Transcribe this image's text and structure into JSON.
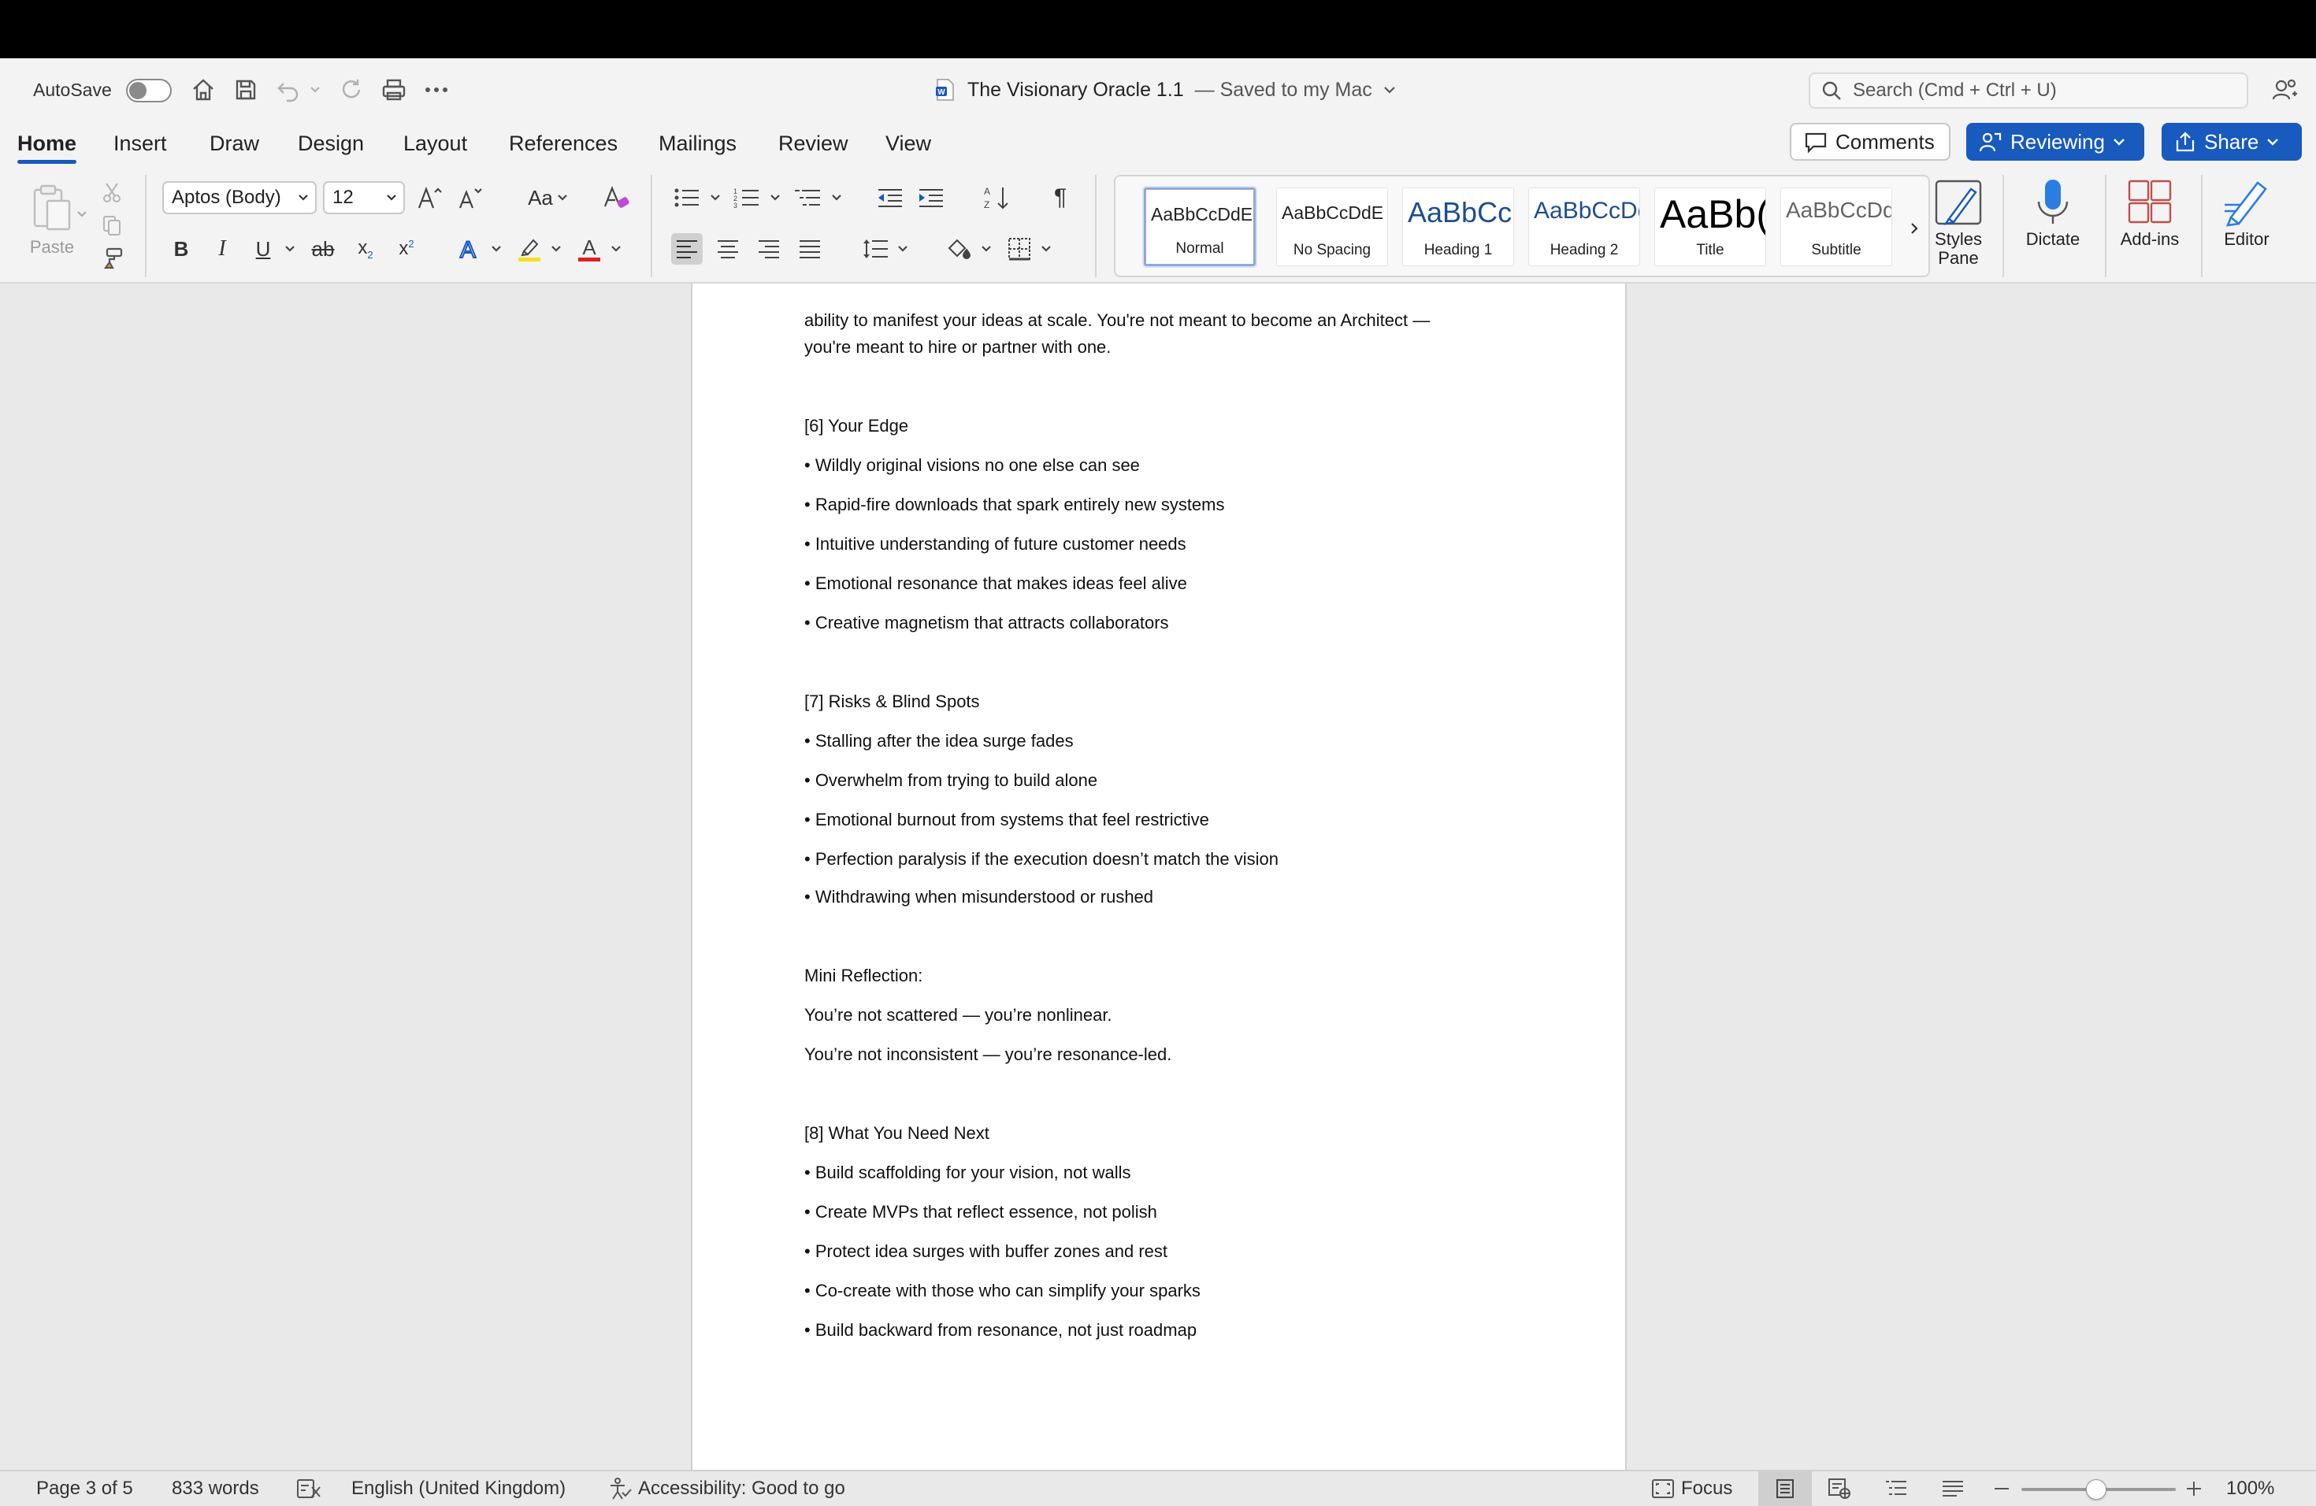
{
  "titlebar": {
    "autosave_label": "AutoSave",
    "doc_name": "The Visionary Oracle  1.1",
    "save_status": "— Saved to my Mac",
    "search_placeholder": "Search (Cmd + Ctrl + U)"
  },
  "tabs": [
    "Home",
    "Insert",
    "Draw",
    "Design",
    "Layout",
    "References",
    "Mailings",
    "Review",
    "View"
  ],
  "actions": {
    "comments": "Comments",
    "reviewing": "Reviewing",
    "share": "Share"
  },
  "ribbon": {
    "paste": "Paste",
    "font_name": "Aptos (Body)",
    "font_size": "12",
    "change_case": "Aa",
    "styles": [
      {
        "preview": "AaBbCcDdE",
        "name": "Normal"
      },
      {
        "preview": "AaBbCcDdE",
        "name": "No Spacing"
      },
      {
        "preview": "AaBbCc",
        "name": "Heading 1"
      },
      {
        "preview": "AaBbCcDd",
        "name": "Heading 2"
      },
      {
        "preview": "AaBb(",
        "name": "Title"
      },
      {
        "preview": "AaBbCcDd",
        "name": "Subtitle"
      }
    ],
    "styles_pane": "Styles Pane",
    "dictate": "Dictate",
    "addins": "Add-ins",
    "editor": "Editor",
    "colors": {
      "accent": "#185abd",
      "highlight": "#f5e21a",
      "font_color": "#e02020"
    }
  },
  "document": {
    "lines": [
      "ability to manifest your ideas at scale. You're not meant to become an Architect —",
      "you're meant to hire or partner with one.",
      "[6] Your Edge",
      "• Wildly original visions no one else can see",
      "• Rapid-fire downloads that spark entirely new systems",
      "• Intuitive understanding of future customer needs",
      "• Emotional resonance that makes ideas feel alive",
      "• Creative magnetism that attracts collaborators",
      "[7] Risks & Blind Spots",
      "• Stalling after the idea surge fades",
      "• Overwhelm from trying to build alone",
      "• Emotional burnout from systems that feel restrictive",
      "• Perfection paralysis if the execution doesn’t match the vision",
      "• Withdrawing when misunderstood or rushed",
      "Mini Reflection:",
      "You’re not scattered — you’re nonlinear.",
      "You’re not inconsistent — you’re resonance-led.",
      "[8] What You Need Next",
      "• Build scaffolding for your vision, not walls",
      "• Create MVPs that reflect essence, not polish",
      "• Protect idea surges with buffer zones and rest",
      "• Co-create with those who can simplify your sparks",
      "• Build backward from resonance, not just roadmap"
    ]
  },
  "status": {
    "page": "Page 3 of 5",
    "words": "833 words",
    "language": "English (United Kingdom)",
    "accessibility": "Accessibility: Good to go",
    "focus": "Focus",
    "zoom": "100%",
    "zoom_level": 1.0
  }
}
